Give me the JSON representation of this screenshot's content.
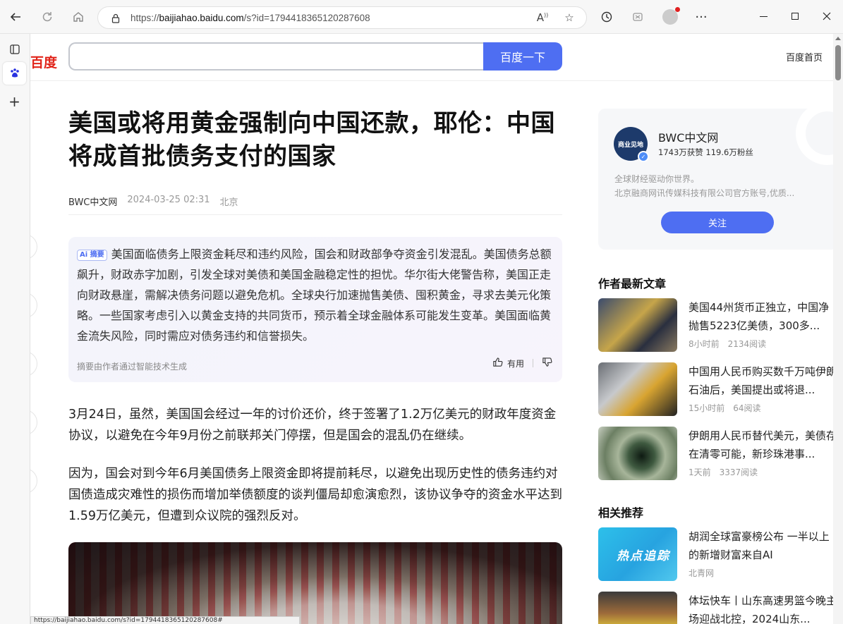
{
  "browser": {
    "url_prefix": "https://",
    "url_domain": "baijiahao.baidu.com",
    "url_path": "/s?id=1794418365120287608",
    "status_url": "https://baijiahao.baidu.com/s?id=1794418365120287608#"
  },
  "header": {
    "logo_text": "百度",
    "search_button": "百度一下",
    "home_link": "百度首页"
  },
  "article": {
    "title": "美国或将用黄金强制向中国还款，耶伦：中国将成首批债务支付的国家",
    "author": "BWC中文网",
    "datetime": "2024-03-25 02:31",
    "location": "北京",
    "ai_badge": "Ai 摘要",
    "ai_summary": "美国面临债务上限资金耗尽和违约风险，国会和财政部争夺资金引发混乱。美国债务总额飙升，财政赤字加剧，引发全球对美债和美国金融稳定性的担忧。华尔街大佬警告称，美国正走向财政悬崖，需解决债务问题以避免危机。全球央行加速抛售美债、囤积黄金，寻求去美元化策略。一些国家考虑引入以黄金支持的共同货币，预示着全球金融体系可能发生变革。美国面临黄金流失风险，同时需应对债务违约和信誉损失。",
    "ai_footer": "摘要由作者通过智能技术生成",
    "ai_useful": "有用",
    "paragraphs": [
      "3月24日，虽然，美国国会经过一年的讨价还价，终于签署了1.2万亿美元的财政年度资金协议，以避免在今年9月份之前联邦关门停摆，但是国会的混乱仍在继续。",
      "因为，国会对到今年6月美国债务上限资金即将提前耗尽，以避免出现历史性的债务违约对国债造成灾难性的损伤而增加举债额度的谈判僵局却愈演愈烈，该协议争夺的资金水平达到1.59万亿美元，但遭到众议院的强烈反对。"
    ]
  },
  "author_card": {
    "avatar_text": "商业见地",
    "name": "BWC中文网",
    "stats": "1743万获赞 119.6万粉丝",
    "desc_line1": "全球财经驱动你世界。",
    "desc_line2": "北京融商网讯传媒科技有限公司官方账号,优质...",
    "follow": "关注"
  },
  "latest": {
    "title": "作者最新文章",
    "items": [
      {
        "title": "美国44州货币正独立，中国净抛售5223亿美债，300多...",
        "time": "8小时前",
        "reads": "2134阅读"
      },
      {
        "title": "中国用人民币购买数千万吨伊朗石油后，美国提出或将退...",
        "time": "15小时前",
        "reads": "64阅读"
      },
      {
        "title": "伊朗用人民币替代美元，美债存在清零可能，新珍珠港事...",
        "time": "1天前",
        "reads": "3337阅读"
      }
    ]
  },
  "related": {
    "title": "相关推荐",
    "items": [
      {
        "title": "胡润全球富豪榜公布 一半以上的新增财富来自AI",
        "source": "北青网",
        "thumb_text": "热点追踪"
      },
      {
        "title": "体坛快车丨山东高速男篮今晚主场迎战北控，2024山东...",
        "source": ""
      }
    ]
  },
  "colors": {
    "accent": "#4e6ef2",
    "logo_red": "#e1251b"
  }
}
